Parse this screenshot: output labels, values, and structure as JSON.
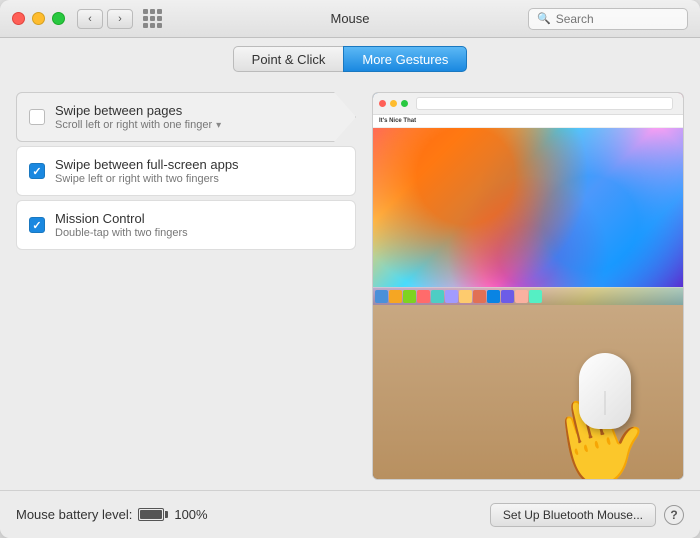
{
  "window": {
    "title": "Mouse",
    "search_placeholder": "Search"
  },
  "tabs": {
    "left": "Point & Click",
    "right": "More Gestures"
  },
  "settings": [
    {
      "id": "swipe-pages",
      "title": "Swipe between pages",
      "desc": "Scroll left or right with one finger",
      "checked": false,
      "has_dropdown": true
    },
    {
      "id": "swipe-fullscreen",
      "title": "Swipe between full-screen apps",
      "desc": "Swipe left or right with two fingers",
      "checked": true,
      "has_dropdown": false
    },
    {
      "id": "mission-control",
      "title": "Mission Control",
      "desc": "Double-tap with two fingers",
      "checked": true,
      "has_dropdown": false
    }
  ],
  "bottom": {
    "battery_label": "Mouse battery level:",
    "battery_percent": "100%",
    "setup_button": "Set Up Bluetooth Mouse...",
    "help_label": "?"
  }
}
